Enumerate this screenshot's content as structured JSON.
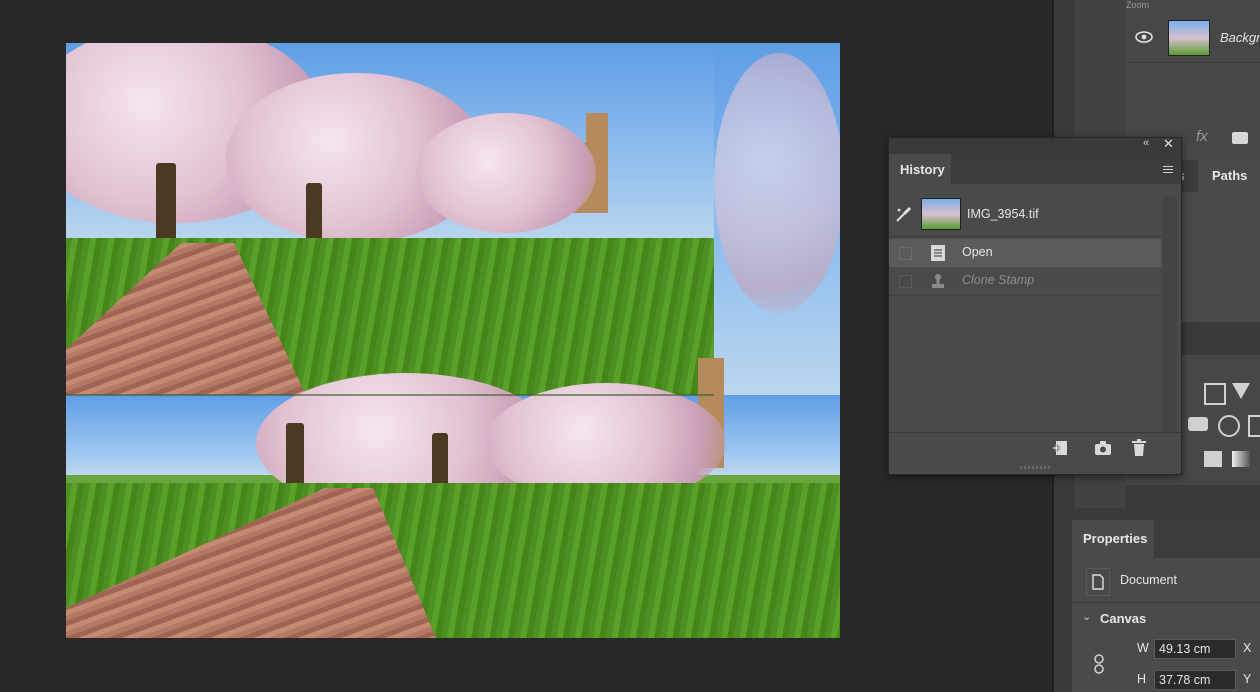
{
  "canvas": {
    "description_alt": "IMG_3954.tif"
  },
  "history_panel": {
    "title": "History",
    "snapshot_name": "IMG_3954.tif",
    "items": [
      {
        "label": "Open",
        "state": "selected"
      },
      {
        "label": "Clone Stamp",
        "state": "undone"
      }
    ]
  },
  "layers_panel": {
    "layer_name": "Backgr",
    "zoom_label": "Zoom"
  },
  "right_tabs": {
    "channels_partial": "ls",
    "paths": "Paths"
  },
  "properties_panel": {
    "title": "Properties",
    "kind": "Document",
    "section": "Canvas",
    "w_label": "W",
    "w_value": "49.13 cm",
    "h_label": "H",
    "h_value": "37.78 cm",
    "x_label": "X",
    "y_label": "Y"
  },
  "icons": {
    "eye": "eye-icon",
    "history_brush": "history-brush-icon",
    "new_document_from_state": "new-document-icon",
    "snapshot": "camera-icon",
    "delete": "trash-icon",
    "panel_menu": "menu-icon",
    "collapse": "double-chevron-icon",
    "close": "close-icon",
    "link": "link-icon"
  },
  "colors": {
    "app_bg": "#282828",
    "panel_bg": "#4a4a4a",
    "selected_row": "#5b5b5b"
  }
}
